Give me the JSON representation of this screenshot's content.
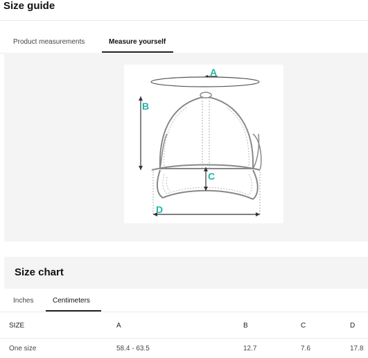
{
  "header": {
    "title": "Size guide"
  },
  "tabs": [
    {
      "label": "Product measurements",
      "active": false
    },
    {
      "label": "Measure yourself",
      "active": true
    }
  ],
  "diagram": {
    "labels": {
      "a": "A",
      "b": "B",
      "c": "C",
      "d": "D"
    },
    "accent_color": "#1fb5a5"
  },
  "size_chart": {
    "title": "Size chart",
    "unit_tabs": [
      {
        "label": "Inches",
        "active": false
      },
      {
        "label": "Centimeters",
        "active": true
      }
    ],
    "columns": [
      "SIZE",
      "A",
      "B",
      "C",
      "D"
    ],
    "rows": [
      [
        "One size",
        "58.4 - 63.5",
        "12.7",
        "7.6",
        "17.8"
      ]
    ]
  }
}
